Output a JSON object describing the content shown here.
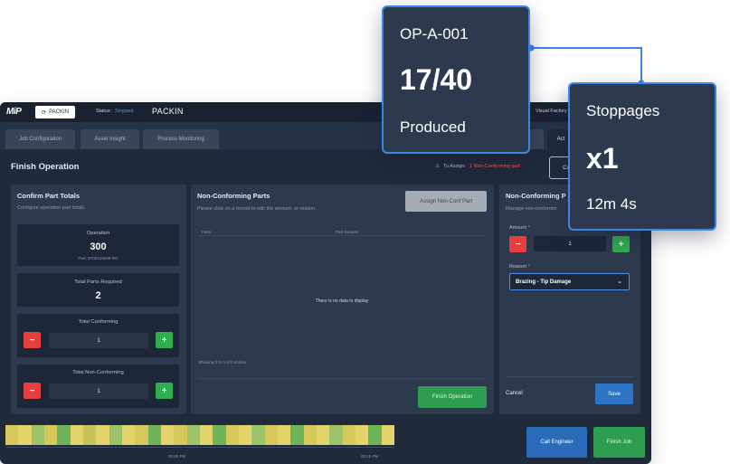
{
  "app": {
    "logo": "MiP",
    "switch_label": "PACKIN",
    "status_label": "Status:",
    "status_value": "Stopped",
    "station": "PACKIN",
    "visual_factory": "Visual Factory"
  },
  "tabs": {
    "job_configuration": "Job Configuration",
    "asset_insight": "Asset Insight",
    "process_monitoring": "Process Monitoring",
    "active": "Act"
  },
  "header": {
    "title": "Finish Operation",
    "assign_label": "To Assign:",
    "assign_value": "1 Non-Conforming part",
    "button": "Ca"
  },
  "confirm": {
    "title": "Confirm Part Totals",
    "subtitle": "Configure operation part totals.",
    "operation_label": "Operation",
    "operation_value": "300",
    "part_number": "Part: 5T00215949-RG",
    "required_label": "Total Parts Required",
    "required_value": "2",
    "conforming_label": "Total Conforming",
    "conforming_value": "1",
    "nonconforming_label": "Total Non-Conforming",
    "nonconforming_value": "1"
  },
  "nonconf": {
    "title": "Non-Conforming Parts",
    "subtitle": "Please click on a record to edit the amount, or reason.",
    "assign_button": "Assign Non-Conf Part",
    "col_parts": "Parts",
    "col_reason": "Part Reason",
    "no_data": "There is no data to display",
    "showing": "Showing 0 to 0 of 0 entries",
    "finish_button": "Finish Operation"
  },
  "detail": {
    "title": "Non-Conforming P",
    "subtitle": "Manage non-conformin",
    "amount_label": "Amount",
    "amount_value": "1",
    "reason_label": "Reason",
    "reason_value": "Brazing - Tip Damage",
    "cancel": "Cancel",
    "save": "Save"
  },
  "footer": {
    "call_engineer": "Call Engineer",
    "finish_job": "Finish Job",
    "tick1": "00:00 PM",
    "tick2": "00:15 PM",
    "timeline_colors": [
      "#d6c85a",
      "#e3d36b",
      "#9dc46b",
      "#d6c85a",
      "#6fb35b",
      "#e3d36b",
      "#c9c25c",
      "#e3d36b",
      "#9dc46b",
      "#e3d36b",
      "#d6c85a",
      "#6fb35b",
      "#e3d36b",
      "#d6c85a",
      "#9dc46b",
      "#e3d36b",
      "#6fb35b",
      "#d6c85a",
      "#e3d36b",
      "#9dc46b",
      "#d6c85a",
      "#e3d36b",
      "#6fb35b",
      "#d6c85a",
      "#e3d36b",
      "#9dc46b",
      "#d6c85a",
      "#e3d36b",
      "#6fb35b",
      "#e3d36b"
    ]
  },
  "popup_produced": {
    "id": "OP-A-001",
    "count": "17/40",
    "label": "Produced"
  },
  "popup_stoppages": {
    "label": "Stoppages",
    "count": "x1",
    "duration": "12m 4s"
  },
  "colors": {
    "accent_blue": "#3c86e8",
    "danger": "#e53e3e",
    "success": "#2fae4f"
  }
}
